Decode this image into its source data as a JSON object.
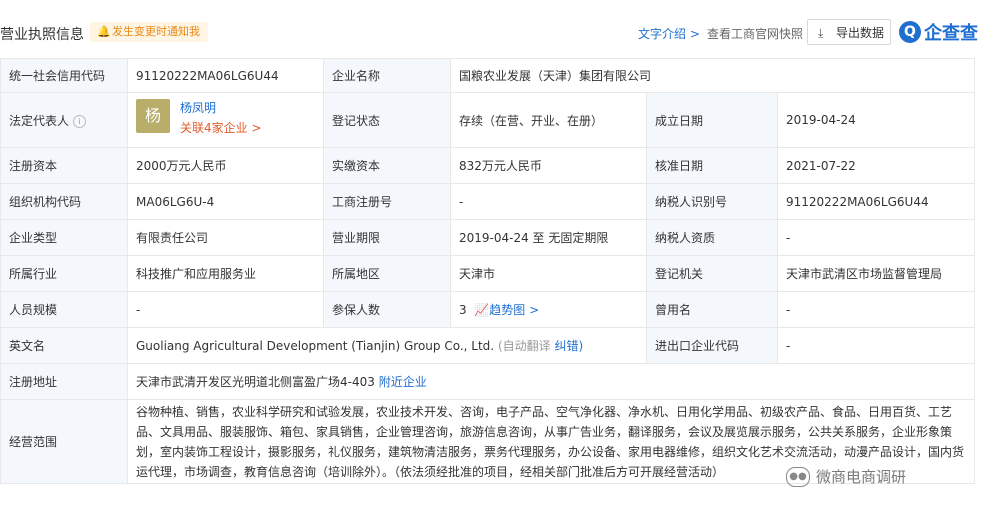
{
  "header": {
    "title": "营业执照信息",
    "notify": "发生变更时通知我",
    "intro_link": "文字介绍 >",
    "snapshot_link": "查看工商官网快照",
    "export_label": "导出数据",
    "logo_mark": "Q",
    "logo_text": "企查查"
  },
  "rows": {
    "credit_code": {
      "label": "统一社会信用代码",
      "value": "91120222MA06LG6U44"
    },
    "company_name": {
      "label": "企业名称",
      "value": "国粮农业发展（天津）集团有限公司"
    },
    "legal_rep": {
      "label": "法定代表人",
      "avatar": "杨",
      "name": "杨凤明",
      "assoc": "关联4家企业 >"
    },
    "reg_status": {
      "label": "登记状态",
      "value": "存续（在营、开业、在册）"
    },
    "est_date": {
      "label": "成立日期",
      "value": "2019-04-24"
    },
    "reg_capital": {
      "label": "注册资本",
      "value": "2000万元人民币"
    },
    "paid_capital": {
      "label": "实缴资本",
      "value": "832万元人民币"
    },
    "approval_date": {
      "label": "核准日期",
      "value": "2021-07-22"
    },
    "org_code": {
      "label": "组织机构代码",
      "value": "MA06LG6U-4"
    },
    "biz_reg_no": {
      "label": "工商注册号",
      "value": "-"
    },
    "taxpayer_id": {
      "label": "纳税人识别号",
      "value": "91120222MA06LG6U44"
    },
    "ent_type": {
      "label": "企业类型",
      "value": "有限责任公司"
    },
    "biz_term": {
      "label": "营业期限",
      "value": "2019-04-24 至 无固定期限"
    },
    "taxpayer_qual": {
      "label": "纳税人资质",
      "value": "-"
    },
    "industry": {
      "label": "所属行业",
      "value": "科技推广和应用服务业"
    },
    "region": {
      "label": "所属地区",
      "value": "天津市"
    },
    "reg_authority": {
      "label": "登记机关",
      "value": "天津市武清区市场监督管理局"
    },
    "staff_size": {
      "label": "人员规模",
      "value": "-"
    },
    "insured": {
      "label": "参保人数",
      "value": "3",
      "trend": "趋势图 >"
    },
    "former_name": {
      "label": "曾用名",
      "value": "-"
    },
    "english_name": {
      "label": "英文名",
      "value": "Guoliang Agricultural Development (Tianjin) Group Co., Ltd.",
      "auto": "(自动翻译",
      "fix": "纠错)"
    },
    "import_export": {
      "label": "进出口企业代码",
      "value": "-"
    },
    "reg_address": {
      "label": "注册地址",
      "value": "天津市武清开发区光明道北侧富盈广场4-403",
      "nearby": "附近企业"
    },
    "biz_scope": {
      "label": "经营范围",
      "value": "谷物种植、销售，农业科学研究和试验发展，农业技术开发、咨询，电子产品、空气净化器、净水机、日用化学用品、初级农产品、食品、日用百货、工艺品、文具用品、服装服饰、箱包、家具销售，企业管理咨询，旅游信息咨询，从事广告业务，翻译服务，会议及展览展示服务，公共关系服务，企业形象策划，室内装饰工程设计，摄影服务，礼仪服务，建筑物清洁服务，票务代理服务，办公设备、家用电器维修，组织文化艺术交流活动，动漫产品设计，国内货运代理，市场调查，教育信息咨询（培训除外）。（依法须经批准的项目，经相关部门批准后方可开展经营活动）"
    }
  },
  "watermark": "微商电商调研"
}
